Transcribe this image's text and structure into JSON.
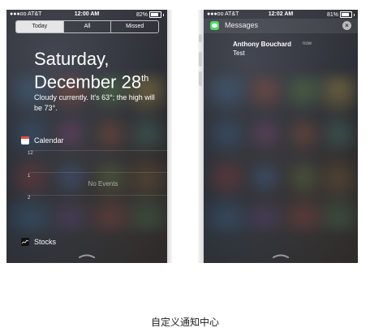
{
  "left_screen": {
    "status": {
      "carrier": "●●●oo AT&T ",
      "time": "12:00 AM",
      "battery": "82%"
    },
    "tabs": [
      {
        "label": "Today",
        "active": true
      },
      {
        "label": "All",
        "active": false
      },
      {
        "label": "Missed",
        "active": false
      }
    ],
    "date_line1": "Saturday,",
    "date_line2": "December 28",
    "date_suffix": "th",
    "weather": "Cloudy currently. It's 63°; the high will be 73°.",
    "calendar": {
      "title": "Calendar",
      "hours": [
        "12",
        "1",
        "2"
      ],
      "empty": "No Events"
    },
    "stocks": {
      "title": "Stocks"
    }
  },
  "right_screen": {
    "status": {
      "carrier": "●●●oo AT&T ",
      "time": "12:02 AM",
      "battery": "81%"
    },
    "app_title": "Messages",
    "sender": "Anthony Bouchard",
    "time_label": "now",
    "message": "Test"
  },
  "caption": "自定义通知中心"
}
